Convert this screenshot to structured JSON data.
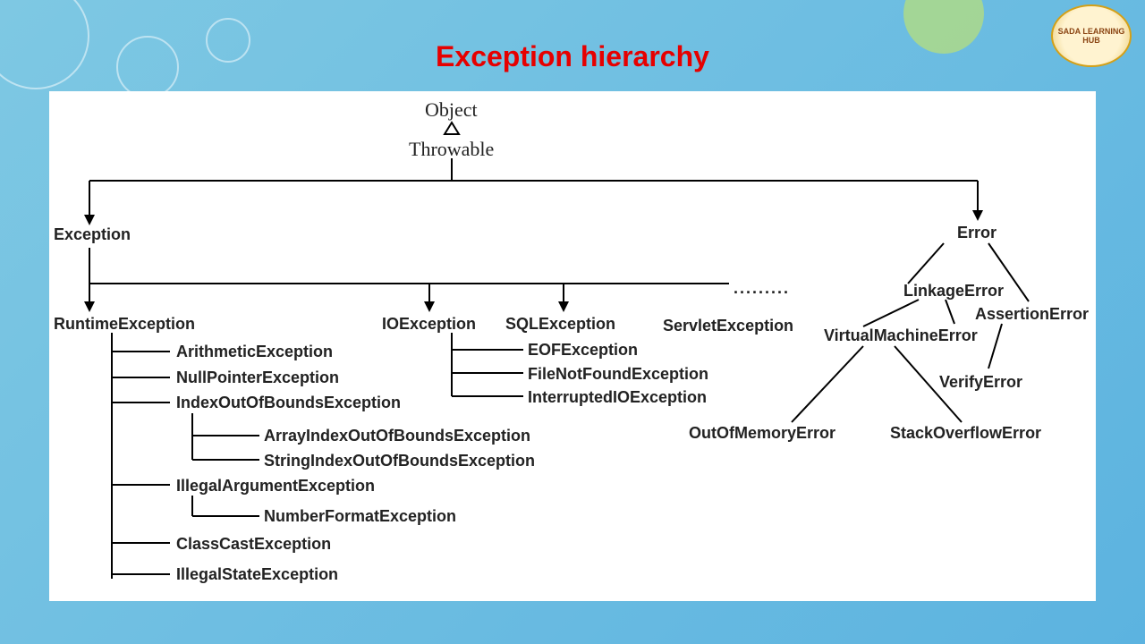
{
  "title": "Exception hierarchy",
  "logo": "SADA LEARNING HUB",
  "root": "Object",
  "throwable": "Throwable",
  "exception": "Exception",
  "error": "Error",
  "runtimeException": "RuntimeException",
  "ioException": "IOException",
  "sqlException": "SQLException",
  "servletException": "ServletException",
  "runtimeChildren": {
    "arithmetic": "ArithmeticException",
    "nullPointer": "NullPointerException",
    "indexOutOfBounds": "IndexOutOfBoundsException",
    "arrayIndex": "ArrayIndexOutOfBoundsException",
    "stringIndex": "StringIndexOutOfBoundsException",
    "illegalArgument": "IllegalArgumentException",
    "numberFormat": "NumberFormatException",
    "classCast": "ClassCastException",
    "illegalState": "IllegalStateException"
  },
  "ioChildren": {
    "eof": "EOFException",
    "fileNotFound": "FileNotFoundException",
    "interruptedIO": "InterruptedIOException"
  },
  "errorChildren": {
    "linkage": "LinkageError",
    "assertion": "AssertionError",
    "virtualMachine": "VirtualMachineError",
    "verify": "VerifyError",
    "outOfMemory": "OutOfMemoryError",
    "stackOverflow": "StackOverflowError"
  },
  "dots": "........."
}
